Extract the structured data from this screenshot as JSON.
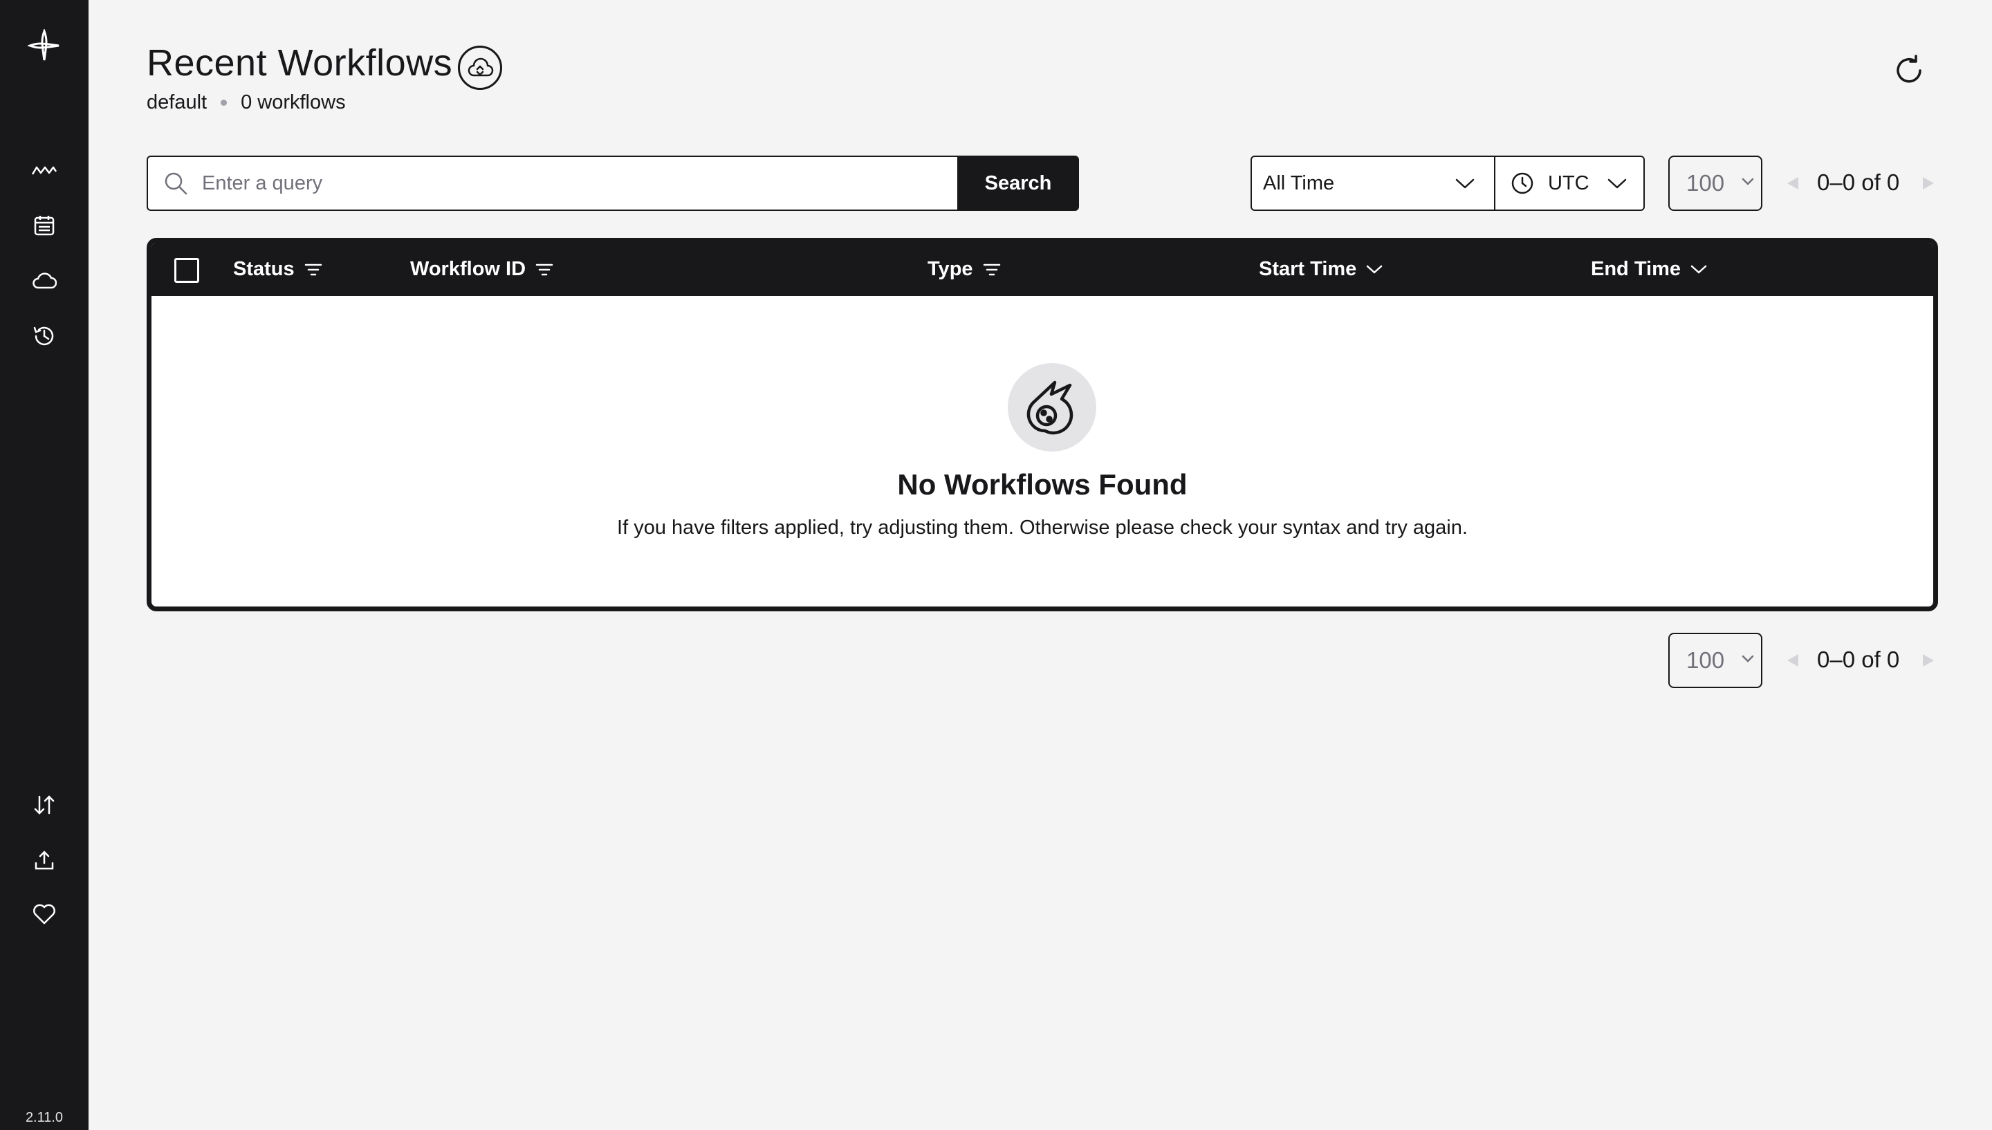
{
  "sidebar": {
    "logo": "temporal-logo-icon",
    "nav": [
      {
        "name": "workflows-icon"
      },
      {
        "name": "schedules-icon"
      },
      {
        "name": "namespaces-icon"
      },
      {
        "name": "archive-icon"
      }
    ],
    "bottom": [
      {
        "name": "import-icon"
      },
      {
        "name": "upload-icon"
      },
      {
        "name": "feedback-icon"
      }
    ],
    "version": "2.11.0"
  },
  "header": {
    "title": "Recent Workflows",
    "namespace": "default",
    "workflow_count": "0 workflows"
  },
  "search": {
    "placeholder": "Enter a query",
    "button_label": "Search"
  },
  "filters": {
    "time_range": "All Time",
    "timezone": "UTC"
  },
  "pagination": {
    "per_page": "100",
    "range_text": "0–0 of 0"
  },
  "table": {
    "columns": {
      "status": "Status",
      "workflow_id": "Workflow ID",
      "type": "Type",
      "start_time": "Start Time",
      "end_time": "End Time"
    },
    "empty": {
      "title": "No Workflows Found",
      "description": "If you have filters applied, try adjusting them. Otherwise please check your syntax and try again."
    }
  },
  "colors": {
    "sidebar_bg": "#18181b",
    "page_bg": "#f4f4f4",
    "accent": "#18181b",
    "muted": "#71717a"
  }
}
